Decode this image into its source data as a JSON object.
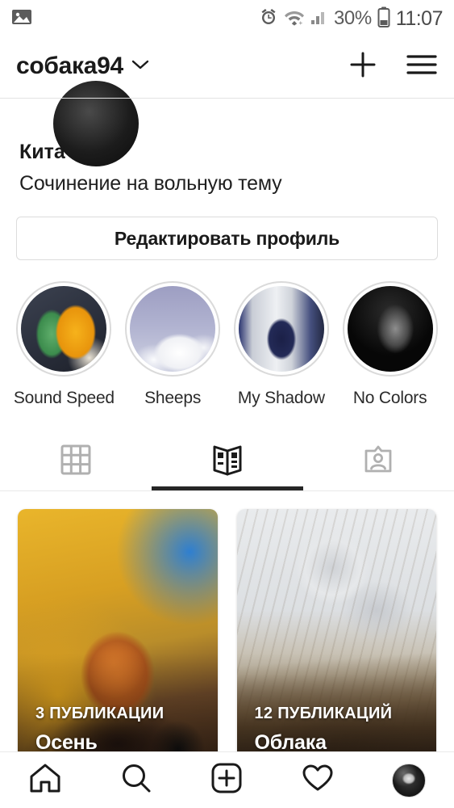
{
  "status_bar": {
    "left_icon": "image-icon",
    "alarm_icon": "alarm-clock-icon",
    "wifi_icon": "wifi-icon",
    "signal_icon": "cellular-signal-icon",
    "battery_percent": "30%",
    "battery_icon": "battery-icon",
    "time": "11:07"
  },
  "header": {
    "username": "собака94",
    "chevron_icon": "chevron-down-icon",
    "add_icon": "plus-icon",
    "menu_icon": "hamburger-menu-icon"
  },
  "profile": {
    "avatar": "profile-avatar",
    "full_name": "Кита",
    "bio": "Сочинение на вольную тему",
    "edit_button_label": "Редактировать профиль"
  },
  "highlights": [
    {
      "label": "Sound Speed",
      "thumb_class": "thumb-leaf"
    },
    {
      "label": "Sheeps",
      "thumb_class": "thumb-sheeps"
    },
    {
      "label": "My Shadow",
      "thumb_class": "thumb-shadow"
    },
    {
      "label": "No Colors",
      "thumb_class": "thumb-nocolors"
    }
  ],
  "tabs": [
    {
      "name": "grid",
      "icon": "grid-icon",
      "active": false
    },
    {
      "name": "guides",
      "icon": "book-guides-icon",
      "active": true
    },
    {
      "name": "tagged",
      "icon": "tagged-person-icon",
      "active": false
    }
  ],
  "guides": [
    {
      "count_label": "3 ПУБЛИКАЦИИ",
      "title": "Осень",
      "bg_class": "bg-autumn"
    },
    {
      "count_label": "12 ПУБЛИКАЦИЙ",
      "title": "Облака",
      "bg_class": "bg-clouds"
    }
  ],
  "bottom_nav": [
    {
      "name": "home",
      "icon": "home-icon"
    },
    {
      "name": "search",
      "icon": "search-icon"
    },
    {
      "name": "create",
      "icon": "add-post-icon"
    },
    {
      "name": "activity",
      "icon": "heart-icon"
    },
    {
      "name": "profile",
      "icon": "profile-avatar-icon"
    }
  ],
  "colors": {
    "text_primary": "#1a1a1a",
    "text_muted": "#5b5b5b",
    "divider": "#e9e9e9",
    "active_tab": "#262626"
  }
}
